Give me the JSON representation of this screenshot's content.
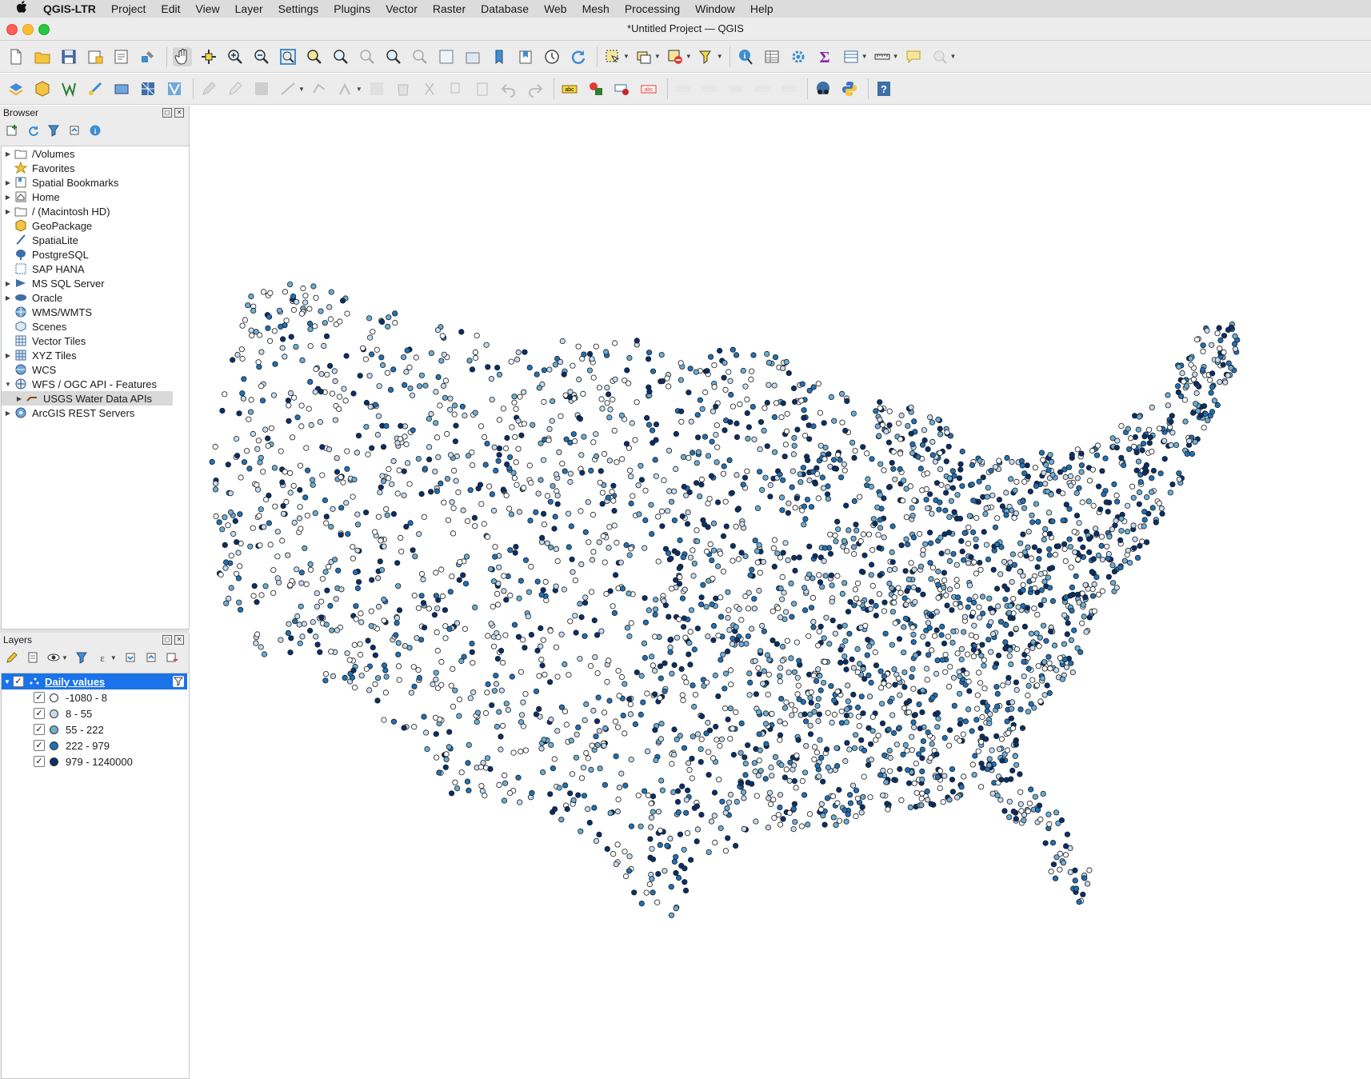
{
  "menubar": {
    "apple": "",
    "items": [
      "QGIS-LTR",
      "Project",
      "Edit",
      "View",
      "Layer",
      "Settings",
      "Plugins",
      "Vector",
      "Raster",
      "Database",
      "Web",
      "Mesh",
      "Processing",
      "Window",
      "Help"
    ]
  },
  "window": {
    "title": "*Untitled Project — QGIS"
  },
  "browser": {
    "title": "Browser",
    "items": [
      {
        "label": "/Volumes",
        "icon": "folder-icon",
        "expand": true
      },
      {
        "label": "Favorites",
        "icon": "star-icon",
        "expand": false
      },
      {
        "label": "Spatial Bookmarks",
        "icon": "bookmark-icon",
        "expand": true
      },
      {
        "label": "Home",
        "icon": "home-icon",
        "expand": true
      },
      {
        "label": "/ (Macintosh HD)",
        "icon": "folder-icon",
        "expand": true
      },
      {
        "label": "GeoPackage",
        "icon": "geopackage-icon",
        "expand": false
      },
      {
        "label": "SpatiaLite",
        "icon": "spatialite-icon",
        "expand": false
      },
      {
        "label": "PostgreSQL",
        "icon": "postgresql-icon",
        "expand": false
      },
      {
        "label": "SAP HANA",
        "icon": "sap-hana-icon",
        "expand": false
      },
      {
        "label": "MS SQL Server",
        "icon": "mssql-icon",
        "expand": true
      },
      {
        "label": "Oracle",
        "icon": "oracle-icon",
        "expand": true
      },
      {
        "label": "WMS/WMTS",
        "icon": "wms-icon",
        "expand": false
      },
      {
        "label": "Scenes",
        "icon": "scenes-icon",
        "expand": false
      },
      {
        "label": "Vector Tiles",
        "icon": "vector-tiles-icon",
        "expand": false
      },
      {
        "label": "XYZ Tiles",
        "icon": "xyz-tiles-icon",
        "expand": true
      },
      {
        "label": "WCS",
        "icon": "wcs-icon",
        "expand": false
      },
      {
        "label": "WFS / OGC API - Features",
        "icon": "wfs-icon",
        "expand": "open"
      },
      {
        "label": "USGS Water Data APIs",
        "icon": "wfs-connection-icon",
        "expand": true,
        "child": true,
        "selected": true
      },
      {
        "label": "ArcGIS REST Servers",
        "icon": "arcgis-icon",
        "expand": true
      }
    ]
  },
  "layers": {
    "title": "Layers",
    "layer_name": "Daily values",
    "legend": [
      {
        "label": "-1080 - 8",
        "color": "#f7fbff"
      },
      {
        "label": "8 - 55",
        "color": "#c6dbef"
      },
      {
        "label": "55 - 222",
        "color": "#6baed6"
      },
      {
        "label": "222 - 979",
        "color": "#2171b5"
      },
      {
        "label": "979 - 1240000",
        "color": "#08306b"
      }
    ]
  },
  "colors": {
    "selection": "#1a73e8",
    "class_colors": [
      "#f7fbff",
      "#c6dbef",
      "#6baed6",
      "#2171b5",
      "#08306b"
    ]
  }
}
